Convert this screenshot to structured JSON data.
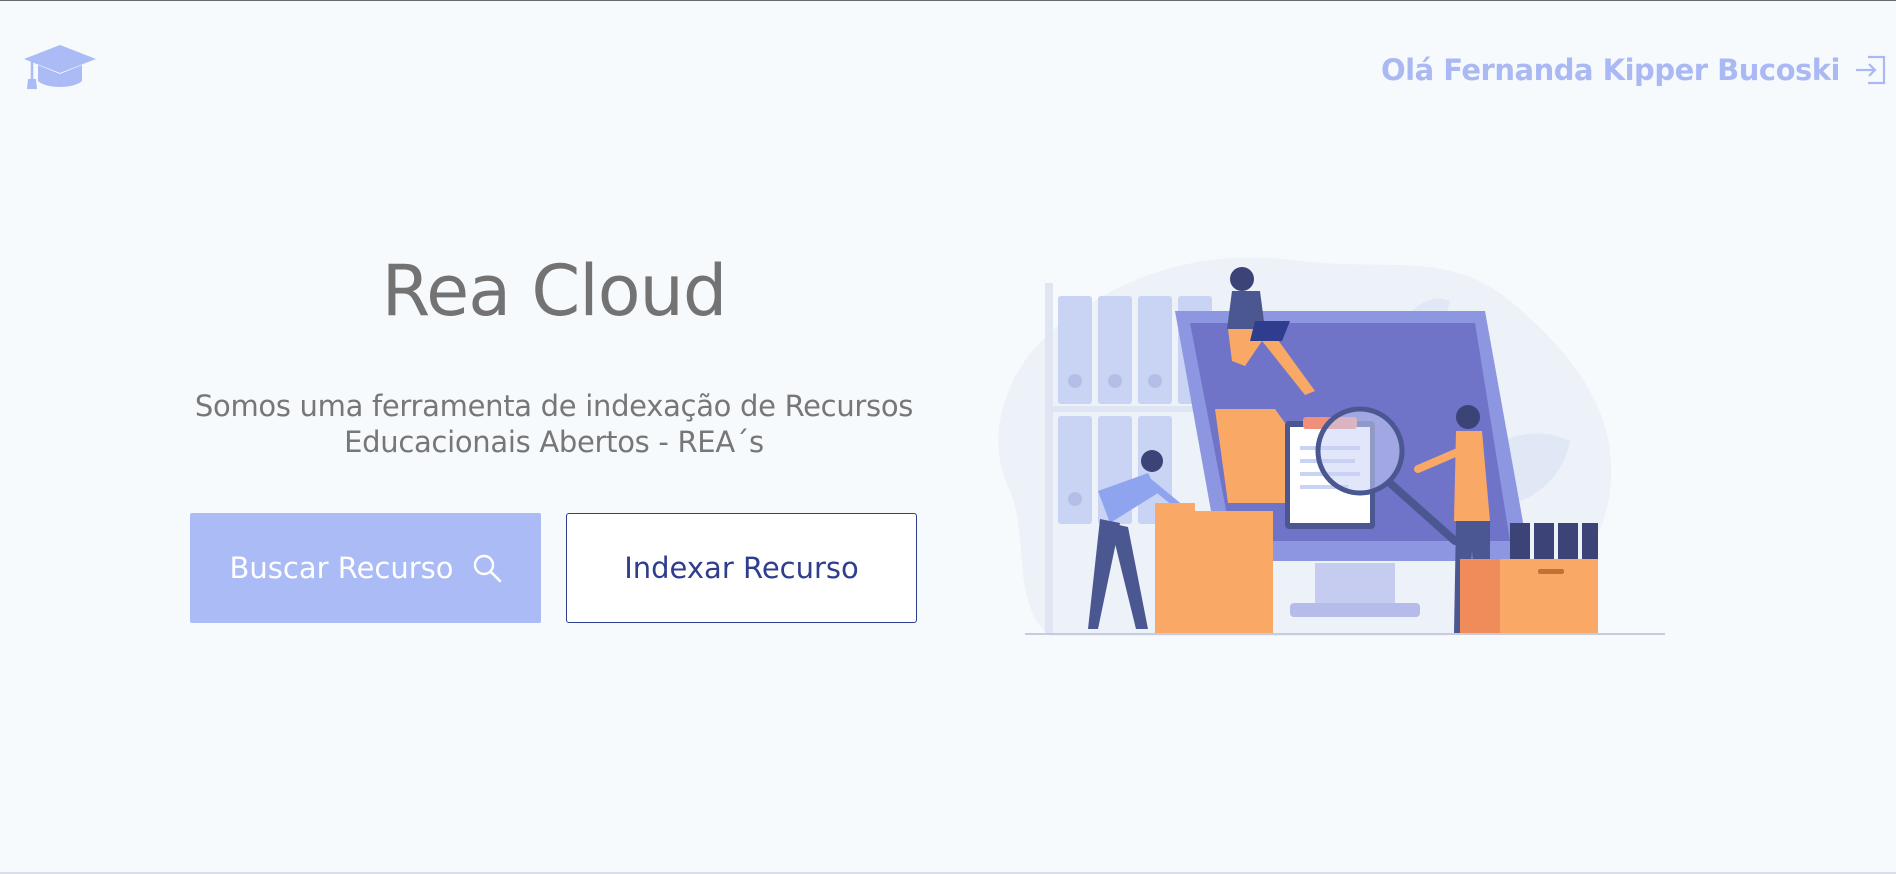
{
  "header": {
    "logo_icon": "graduation-cap-icon",
    "greeting": "Olá Fernanda Kipper Bucoski",
    "logout_icon": "sign-out-icon"
  },
  "hero": {
    "title": "Rea Cloud",
    "subtitle_line1": "Somos uma ferramenta de indexação de Recursos",
    "subtitle_line2": "Educacionais Abertos - REA´s"
  },
  "actions": {
    "search_label": "Buscar Recurso",
    "search_icon": "search-icon",
    "index_label": "Indexar Recurso"
  },
  "colors": {
    "accent": "#aabbf6",
    "primary_dark": "#2f3d8f",
    "title_text": "#737373",
    "background": "#f7fafd",
    "illustration_orange": "#f9a865"
  }
}
